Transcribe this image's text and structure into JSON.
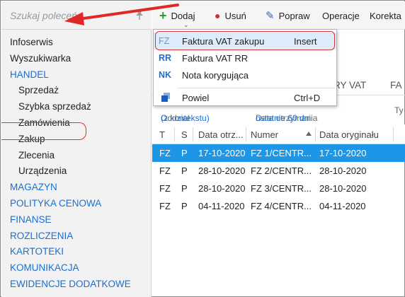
{
  "sidebar": {
    "search_placeholder": "Szukaj poleceń",
    "items": [
      {
        "label": "Infoserwis"
      },
      {
        "label": "Wyszukiwarka"
      },
      {
        "label": "HANDEL"
      },
      {
        "label": "Sprzedaż"
      },
      {
        "label": "Szybka sprzedaż"
      },
      {
        "label": "Zamówienia"
      },
      {
        "label": "Zakup"
      },
      {
        "label": "Zlecenia"
      },
      {
        "label": "Urządzenia"
      },
      {
        "label": "MAGAZYN"
      },
      {
        "label": "POLITYKA CENOWA"
      },
      {
        "label": "FINANSE"
      },
      {
        "label": "ROZLICZENIA"
      },
      {
        "label": "KARTOTEKI"
      },
      {
        "label": "KOMUNIKACJA"
      },
      {
        "label": "EWIDENCJE DODATKOWE"
      }
    ]
  },
  "toolbar": {
    "add_label": "Dodaj",
    "delete_label_partial": "Usuń",
    "fix_label": "Popraw",
    "operations_label": "Operacje",
    "correction_label": "Korekta"
  },
  "tabs": {
    "tab1": "RY VAT",
    "tab2": "FA"
  },
  "filter": {
    "division_label": "Oddział",
    "division_value": "(z kontekstu)",
    "date_label": "Data otrzymania",
    "date_value": "ostatnie 60 dni",
    "type_partial": "Ty"
  },
  "table": {
    "columns": [
      "T",
      "S",
      "Data otrz...",
      "Numer",
      "Data oryginału"
    ],
    "rows": [
      {
        "t": "FZ",
        "s": "P",
        "date": "17-10-2020",
        "number": "FZ 1/CENTR...",
        "orig_date": "17-10-2020"
      },
      {
        "t": "FZ",
        "s": "P",
        "date": "28-10-2020",
        "number": "FZ 2/CENTR...",
        "orig_date": "28-10-2020"
      },
      {
        "t": "FZ",
        "s": "P",
        "date": "28-10-2020",
        "number": "FZ 3/CENTR...",
        "orig_date": "28-10-2020"
      },
      {
        "t": "FZ",
        "s": "P",
        "date": "04-11-2020",
        "number": "FZ 4/CENTR...",
        "orig_date": "04-11-2020"
      }
    ]
  },
  "dropdown": {
    "items": [
      {
        "icon": "FZ",
        "label": "Faktura VAT zakupu",
        "shortcut": "Insert"
      },
      {
        "icon": "RR",
        "label": "Faktura VAT RR",
        "shortcut": ""
      },
      {
        "icon": "NK",
        "label": "Nota korygująca",
        "shortcut": ""
      },
      {
        "icon": "copy-icon",
        "label": "Powiel",
        "shortcut": "Ctrl+D"
      }
    ]
  },
  "colors": {
    "accent": "#1a6fd0",
    "selected_row": "#1e96e8",
    "annotation": "#e03030",
    "plus": "#2a9a2a"
  }
}
